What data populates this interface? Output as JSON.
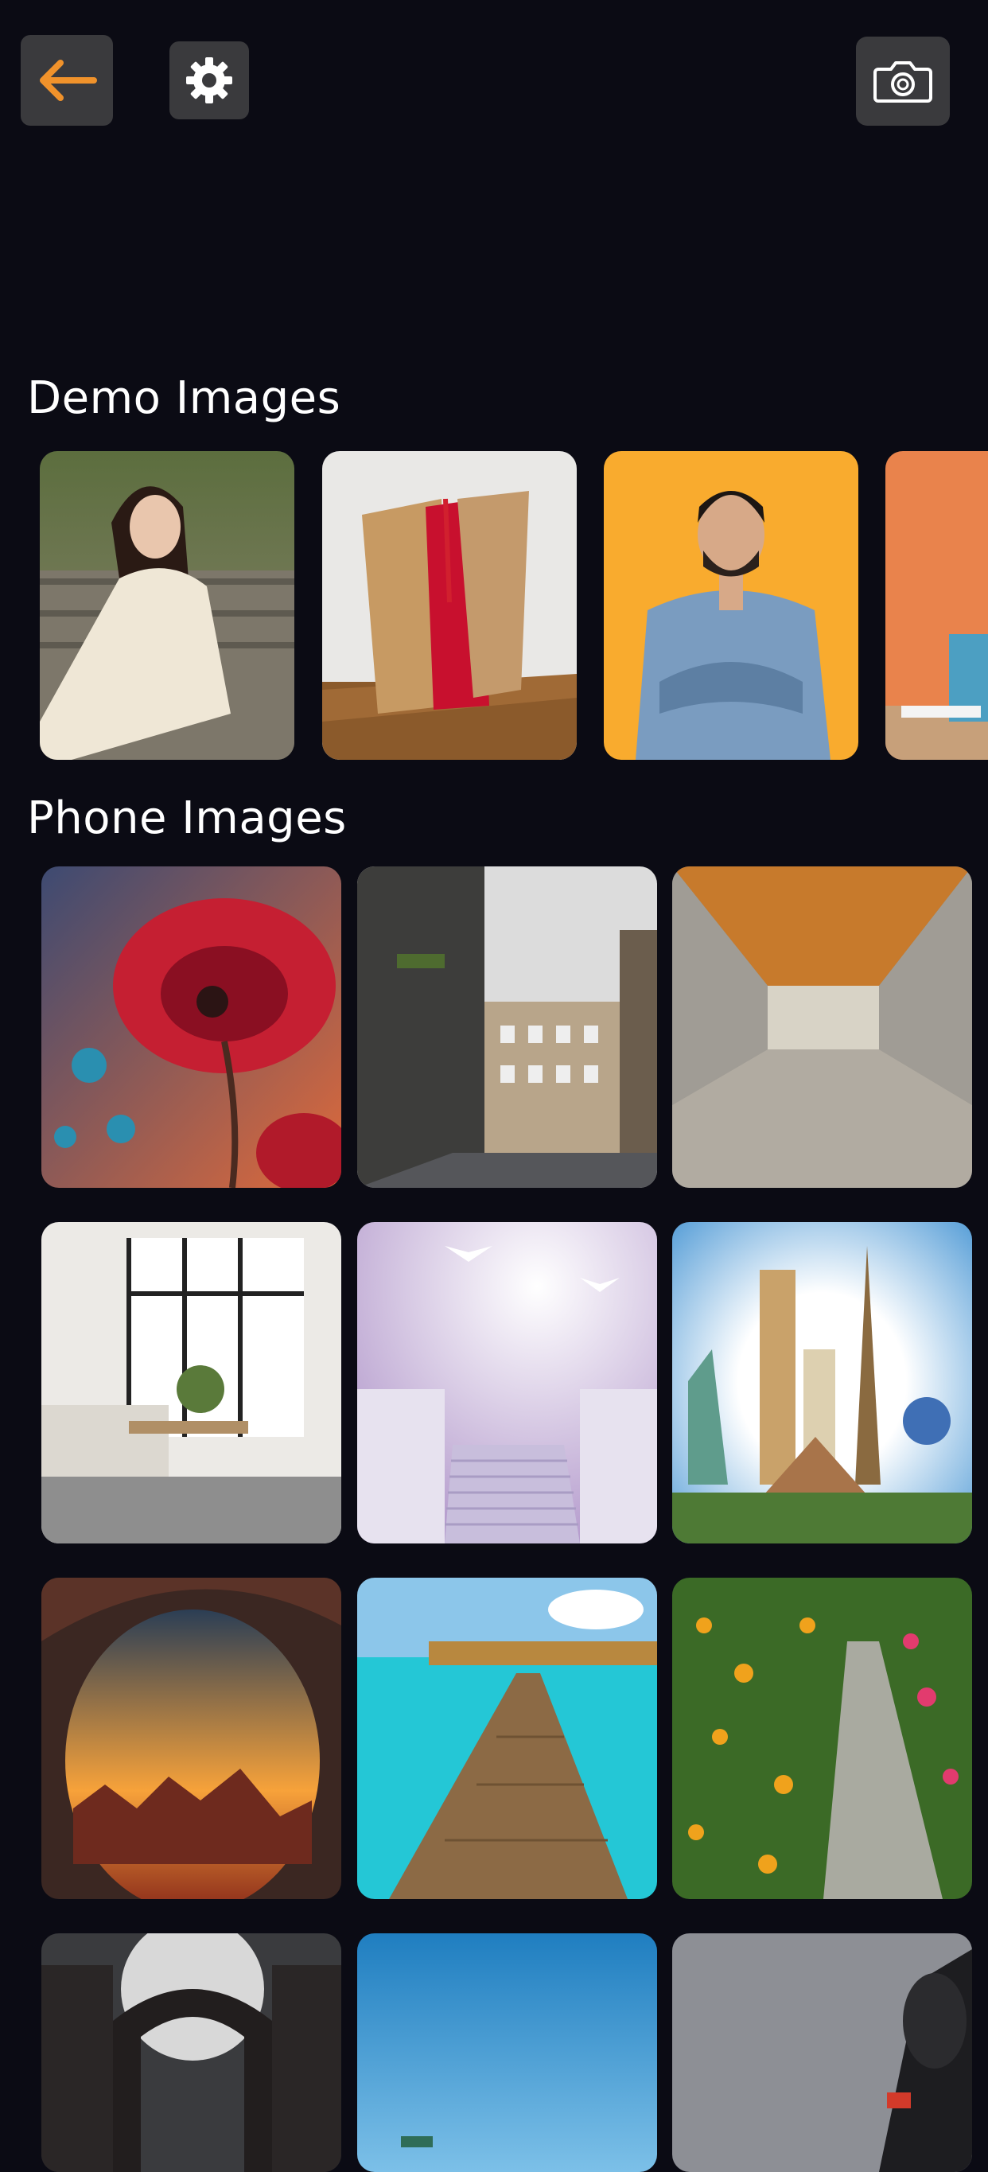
{
  "header": {
    "back_icon": "arrow-left-icon",
    "settings_icon": "gear-icon",
    "camera_icon": "camera-icon",
    "accent_color": "#f0922b"
  },
  "sections": {
    "demo_title": "Demo Images",
    "phone_title": "Phone Images"
  },
  "demo_images": [
    {
      "subject": "woman-sitting-photo"
    },
    {
      "subject": "books-on-shelf-photo"
    },
    {
      "subject": "man-arms-crossed-photo"
    },
    {
      "subject": "desk-orange-wall-photo"
    }
  ],
  "phone_images": [
    {
      "subject": "red-flower-art"
    },
    {
      "subject": "city-street"
    },
    {
      "subject": "empty-hallway"
    },
    {
      "subject": "living-room"
    },
    {
      "subject": "heavenly-stairs-doves"
    },
    {
      "subject": "world-landmarks"
    },
    {
      "subject": "rock-arch-sunset"
    },
    {
      "subject": "wooden-pier-sea"
    },
    {
      "subject": "garden-path-flowers"
    },
    {
      "subject": "moon-stone-gate"
    },
    {
      "subject": "blue-sky-coast"
    },
    {
      "subject": "microphone-gray"
    }
  ]
}
